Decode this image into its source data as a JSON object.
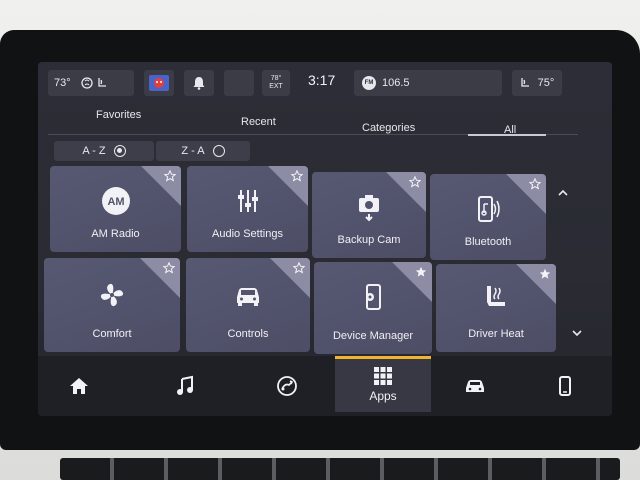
{
  "statusbar": {
    "temp_left": "73°",
    "ext_temp_value": "78°",
    "ext_temp_label": "EXT",
    "time": "3:17",
    "radio_band": "FM",
    "radio_station": "106.5",
    "temp_right": "75°"
  },
  "tabs": [
    {
      "label": "Favorites"
    },
    {
      "label": "Recent"
    },
    {
      "label": "Categories"
    },
    {
      "label": "All",
      "active": true
    }
  ],
  "sort": {
    "az_label": "A - Z",
    "az_selected": true,
    "za_label": "Z - A",
    "za_selected": false
  },
  "apps": [
    {
      "label": "AM Radio",
      "icon": "am-radio-icon",
      "badge": "AM",
      "favorite": false
    },
    {
      "label": "Audio Settings",
      "icon": "audio-settings-icon",
      "favorite": false
    },
    {
      "label": "Backup Cam",
      "icon": "backup-cam-icon",
      "favorite": false
    },
    {
      "label": "Bluetooth",
      "icon": "bluetooth-phone-icon",
      "favorite": false
    },
    {
      "label": "Comfort",
      "icon": "fan-icon",
      "favorite": false
    },
    {
      "label": "Controls",
      "icon": "car-icon",
      "favorite": false
    },
    {
      "label": "Device Manager",
      "icon": "device-manager-icon",
      "favorite": true
    },
    {
      "label": "Driver Heat",
      "icon": "heated-seat-icon",
      "favorite": true
    }
  ],
  "nav": {
    "items": [
      {
        "name": "home",
        "icon": "home-icon"
      },
      {
        "name": "media",
        "icon": "music-note-icon"
      },
      {
        "name": "navigation",
        "icon": "navigation-icon"
      },
      {
        "name": "apps",
        "icon": "apps-grid-icon",
        "label": "Apps",
        "active": true
      },
      {
        "name": "vehicle",
        "icon": "car-icon"
      },
      {
        "name": "phone",
        "icon": "phone-icon"
      }
    ]
  },
  "colors": {
    "accent": "#f0b430",
    "tile": "#52536c",
    "background": "#2b2c34"
  }
}
